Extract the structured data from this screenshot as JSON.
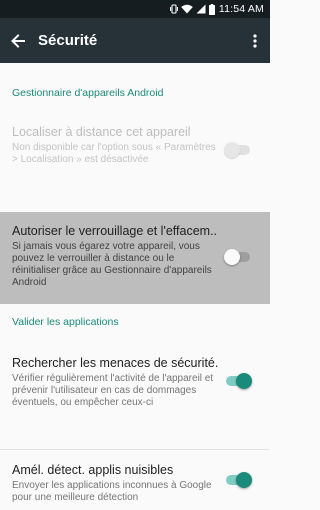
{
  "status_bar": {
    "time": "11:54 AM"
  },
  "app_bar": {
    "title": "Sécurité"
  },
  "sections": {
    "device_manager": "Gestionnaire d'appareils Android",
    "verify_apps": "Valider les applications"
  },
  "items": {
    "locate": {
      "title": "Localiser à distance cet appareil",
      "summary": "Non disponible car l'option sous « Paramètres > Localisation » est désactivée",
      "toggle": "off"
    },
    "lock_erase": {
      "title": "Autoriser le verrouillage et l'effacem..",
      "summary": "Si jamais vous égarez votre appareil, vous pouvez le verrouiller à distance ou le réinitialiser grâce au Gestionnaire d'appareils Android",
      "toggle": "off"
    },
    "scan": {
      "title": "Rechercher les menaces de sécurité..",
      "summary": "Vérifier régulièrement l'activité de l'appareil et prévenir l'utilisateur en cas de dommages éventuels, ou empêcher ceux-ci",
      "toggle": "on"
    },
    "improve": {
      "title": "Amél. détect. applis nuisibles",
      "summary": "Envoyer les applications inconnues à Google pour une meilleure détection",
      "toggle": "on"
    }
  },
  "colors": {
    "accent": "#1a8a7a",
    "appbar": "#263238",
    "statusbar": "#161d21"
  }
}
